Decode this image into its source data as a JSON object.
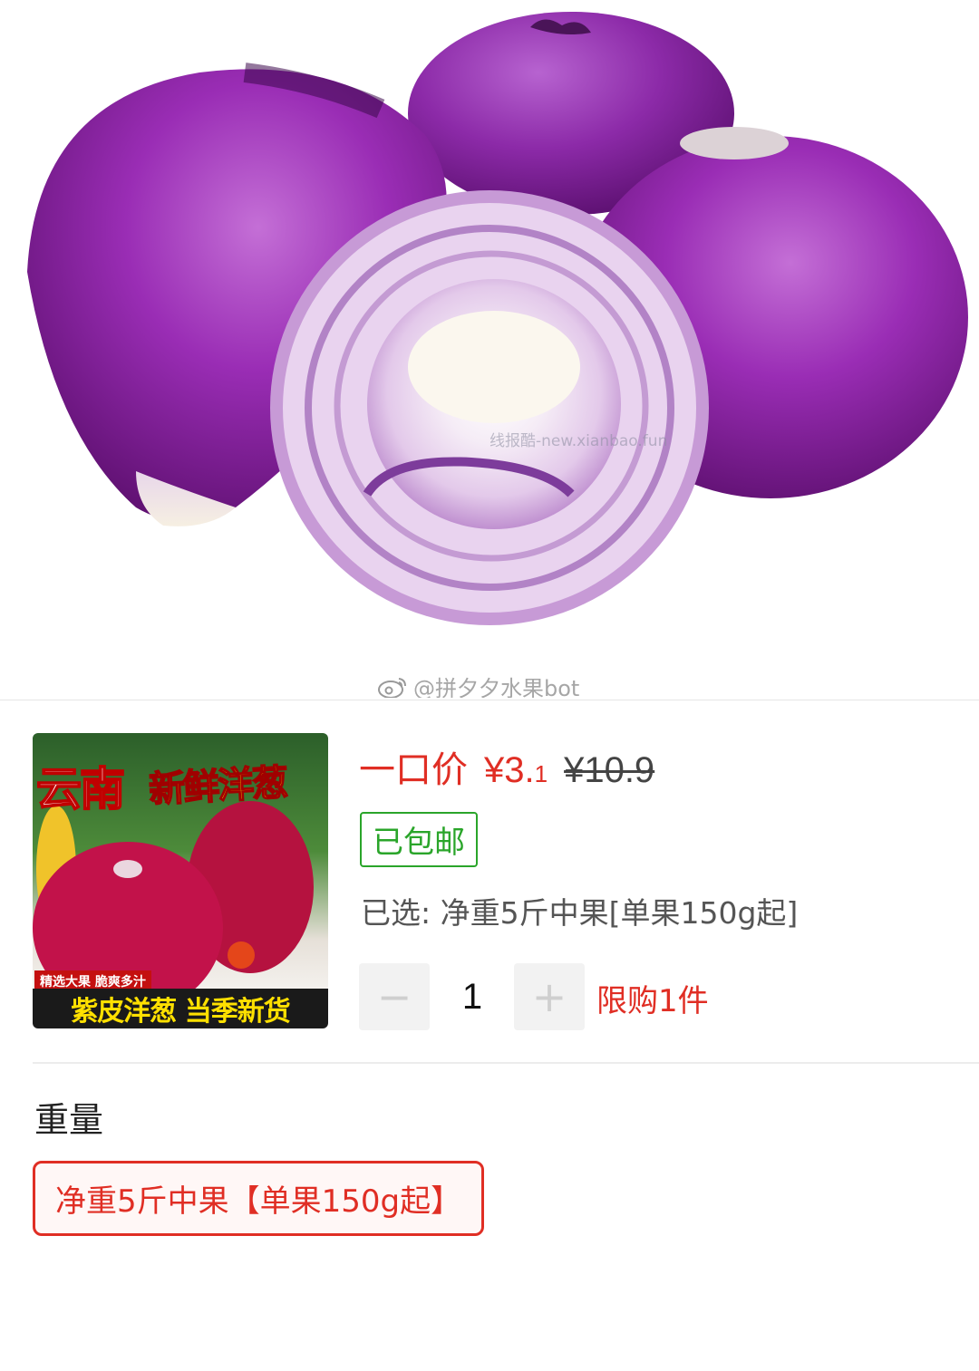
{
  "hero": {
    "watermark_site": "线报酷-new.xianbao.fun",
    "watermark_account": "@拼夕夕水果bot",
    "icon": "weibo-icon"
  },
  "product": {
    "thumbnail_text": {
      "title_red": "云南",
      "title_yellow": "新鲜洋葱",
      "chip": "精选大果 脆爽多汁",
      "banner": "紫皮洋葱 当季新货"
    },
    "price_label": "一口价",
    "currency": "¥",
    "price_main": "3.",
    "price_decimal": "1",
    "original_price": "¥10.9",
    "shipping_badge": "已包邮",
    "selected": "已选: 净重5斤中果[单果150g起]",
    "quantity": {
      "minus": "−",
      "value": "1",
      "plus": "+"
    },
    "limit_text": "限购1件"
  },
  "spec": {
    "title": "重量",
    "option": "净重5斤中果【单果150g起】"
  },
  "colors": {
    "accent_red": "#e02e24",
    "ship_green": "#2aa52a",
    "onion_purple": "#8e2aa6"
  }
}
